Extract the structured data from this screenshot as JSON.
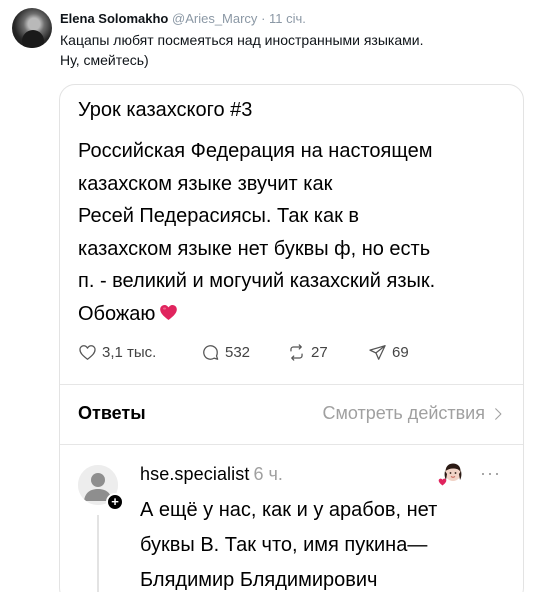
{
  "tweet": {
    "author_name": "Elena Solomakho",
    "author_handle": "@Aries_Marcy",
    "separator": "·",
    "time": "11 січ.",
    "text_lines": [
      "Кацапы любят посмеяться над иностранными языками.",
      "Ну, смейтесь)"
    ]
  },
  "card": {
    "title": "Урок казахского #3",
    "body_lines": [
      "Российская Федерация на настоящем",
      "казахском языке звучит как",
      "Ресей Педерасиясы. Так как в",
      "казахском языке нет буквы ф, но есть",
      "п. - великий и могучий казахский язык.",
      "Обожаю"
    ],
    "heart_emoji_icon": "red-heart-icon",
    "actions": {
      "likes": "3,1 тыс.",
      "comments": "532",
      "reposts": "27",
      "shares": "69"
    },
    "replies_label": "Ответы",
    "view_activity_label": "Смотреть действия",
    "reply": {
      "username": "hse.specialist",
      "time": "6 ч.",
      "more": "···",
      "text_lines": [
        "А ещё у нас,  как и у арабов,  нет",
        "буквы В. Так что,  имя пукина—",
        "Блядимир Блядимирович"
      ]
    },
    "colors": {
      "heart": "#e0245e",
      "muted": "#a0a0a0",
      "border": "#e3e3e3"
    }
  }
}
